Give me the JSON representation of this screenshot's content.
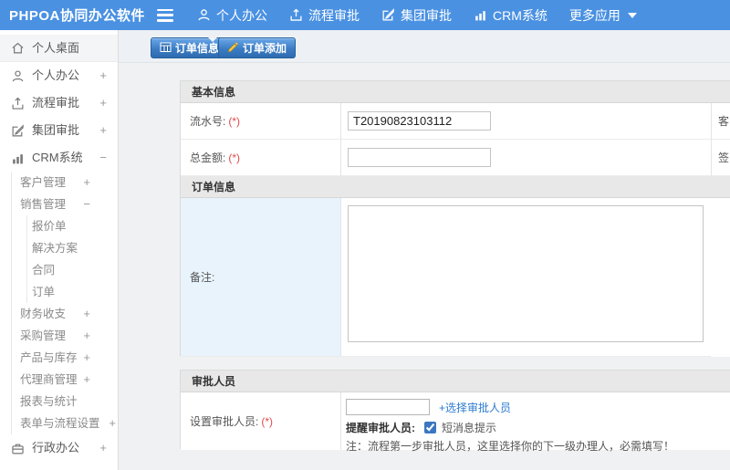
{
  "app": {
    "title": "PHPOA协同办公软件"
  },
  "topnav": {
    "items": [
      {
        "label": "个人办公"
      },
      {
        "label": "流程审批"
      },
      {
        "label": "集团审批"
      },
      {
        "label": "CRM系统"
      },
      {
        "label": "更多应用"
      }
    ]
  },
  "tabs": [
    {
      "label": "订单信息"
    },
    {
      "label": "订单添加"
    }
  ],
  "sidebar": {
    "items": [
      {
        "label": "个人桌面",
        "suffix": ""
      },
      {
        "label": "个人办公",
        "suffix": "+"
      },
      {
        "label": "流程审批",
        "suffix": "+"
      },
      {
        "label": "集团审批",
        "suffix": "+"
      },
      {
        "label": "CRM系统",
        "suffix": "−"
      },
      {
        "label": "客户管理",
        "suffix": "+"
      },
      {
        "label": "销售管理",
        "suffix": "−"
      },
      {
        "label": "报价单",
        "suffix": ""
      },
      {
        "label": "解决方案",
        "suffix": ""
      },
      {
        "label": "合同",
        "suffix": ""
      },
      {
        "label": "订单",
        "suffix": ""
      },
      {
        "label": "财务收支",
        "suffix": "+"
      },
      {
        "label": "采购管理",
        "suffix": "+"
      },
      {
        "label": "产品与库存",
        "suffix": "+"
      },
      {
        "label": "代理商管理",
        "suffix": "+"
      },
      {
        "label": "报表与统计",
        "suffix": ""
      },
      {
        "label": "表单与流程设置",
        "suffix": "+"
      },
      {
        "label": "行政办公",
        "suffix": "+"
      }
    ]
  },
  "form": {
    "basic": {
      "title": "基本信息",
      "serial": {
        "label": "流水号:",
        "required": "(*)",
        "value": "T20190823103112",
        "clipped": "客"
      },
      "amount": {
        "label": "总金额:",
        "required": "(*)",
        "value": "",
        "clipped": "签"
      }
    },
    "order": {
      "title": "订单信息",
      "remark_label": "备注:"
    },
    "approver": {
      "title": "审批人员",
      "label": "设置审批人员:",
      "required": "(*)",
      "picker_value": "",
      "link": "+选择审批人员",
      "remind": "提醒审批人员:",
      "sms": "短消息提示",
      "note": "注：流程第一步审批人员，这里选择你的下一级办理人，必需填写！"
    }
  },
  "colors": {
    "topnav_blue": "#4a91e2",
    "tab_blue": "#2e6cb0",
    "link_blue": "#2b7bd0",
    "required_red": "#e04b4b",
    "remark_bg": "#e9f3fb",
    "section_header_bg": "#e8e8e8"
  }
}
